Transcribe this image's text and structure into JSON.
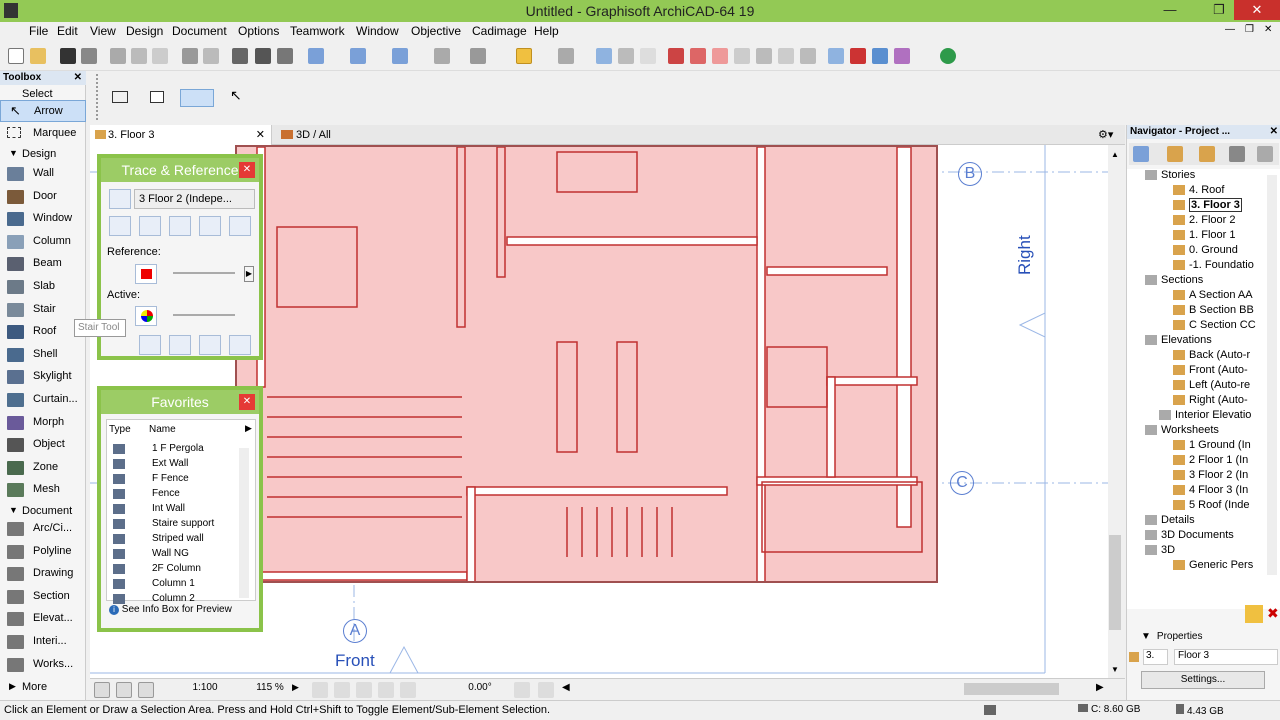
{
  "window": {
    "title": "Untitled - Graphisoft ArchiCAD-64 19"
  },
  "menu": [
    "File",
    "Edit",
    "View",
    "Design",
    "Document",
    "Options",
    "Teamwork",
    "Window",
    "Objective",
    "Cadimage",
    "Help"
  ],
  "toolbox": {
    "title": "Toolbox",
    "select_section": "Select",
    "select_tools": [
      "Arrow",
      "Marquee"
    ],
    "design_section": "Design",
    "design_tools": [
      "Wall",
      "Door",
      "Window",
      "Column",
      "Beam",
      "Slab",
      "Stair",
      "Roof",
      "Shell",
      "Skylight",
      "Curtain...",
      "Morph",
      "Object",
      "Zone",
      "Mesh"
    ],
    "document_section": "Document",
    "document_tools": [
      "Arc/Ci...",
      "Polyline",
      "Drawing",
      "Section",
      "Elevat...",
      "Interi...",
      "Works..."
    ],
    "more": "More",
    "tooltip": "Stair Tool"
  },
  "tabs": {
    "floor": "3. Floor 3",
    "three_d": "3D / All"
  },
  "trace_panel": {
    "title": "Trace & Reference",
    "dropdown": "3 Floor 2 (Indepe...",
    "reference_label": "Reference:",
    "active_label": "Active:"
  },
  "favorites": {
    "title": "Favorites",
    "col_type": "Type",
    "col_name": "Name",
    "items": [
      "1 F Pergola",
      "Ext Wall",
      "F Fence",
      "Fence",
      "Int Wall",
      "Staire support",
      "Striped wall",
      "Wall NG",
      "2F Column",
      "Column 1",
      "Column 2"
    ],
    "hint": "See Info Box for Preview"
  },
  "canvas": {
    "label_front": "Front",
    "label_right": "Right",
    "axis_a": "A",
    "axis_b": "B",
    "axis_c": "C"
  },
  "bottombar": {
    "scale": "1:100",
    "zoom": "115 %",
    "angle": "0.00°"
  },
  "navigator": {
    "title": "Navigator - Project ...",
    "stories_label": "Stories",
    "stories": [
      "4. Roof",
      "3. Floor 3",
      "2. Floor 2",
      "1. Floor 1",
      "0. Ground",
      "-1. Foundatio"
    ],
    "sections_label": "Sections",
    "sections": [
      "A Section AA",
      "B Section BB",
      "C Section CC"
    ],
    "elevations_label": "Elevations",
    "elevations": [
      "Back (Auto-r",
      "Front (Auto-",
      "Left (Auto-re",
      "Right (Auto-"
    ],
    "interior_label": "Interior Elevatio",
    "worksheets_label": "Worksheets",
    "worksheets": [
      "1 Ground (In",
      "2 Floor 1 (In",
      "3 Floor 2 (In",
      "4 Floor 3 (In",
      "5 Roof (Inde"
    ],
    "details_label": "Details",
    "documents_3d_label": "3D Documents",
    "three_d_label": "3D",
    "generic_persp": "Generic Pers",
    "properties_label": "Properties",
    "prop_number": "3.",
    "prop_name": "Floor 3",
    "settings_button": "Settings..."
  },
  "status": {
    "message": "Click an Element or Draw a Selection Area. Press and Hold Ctrl+Shift to Toggle Element/Sub-Element Selection.",
    "disk_c": "C: 8.60 GB",
    "memory": "4.43 GB"
  }
}
